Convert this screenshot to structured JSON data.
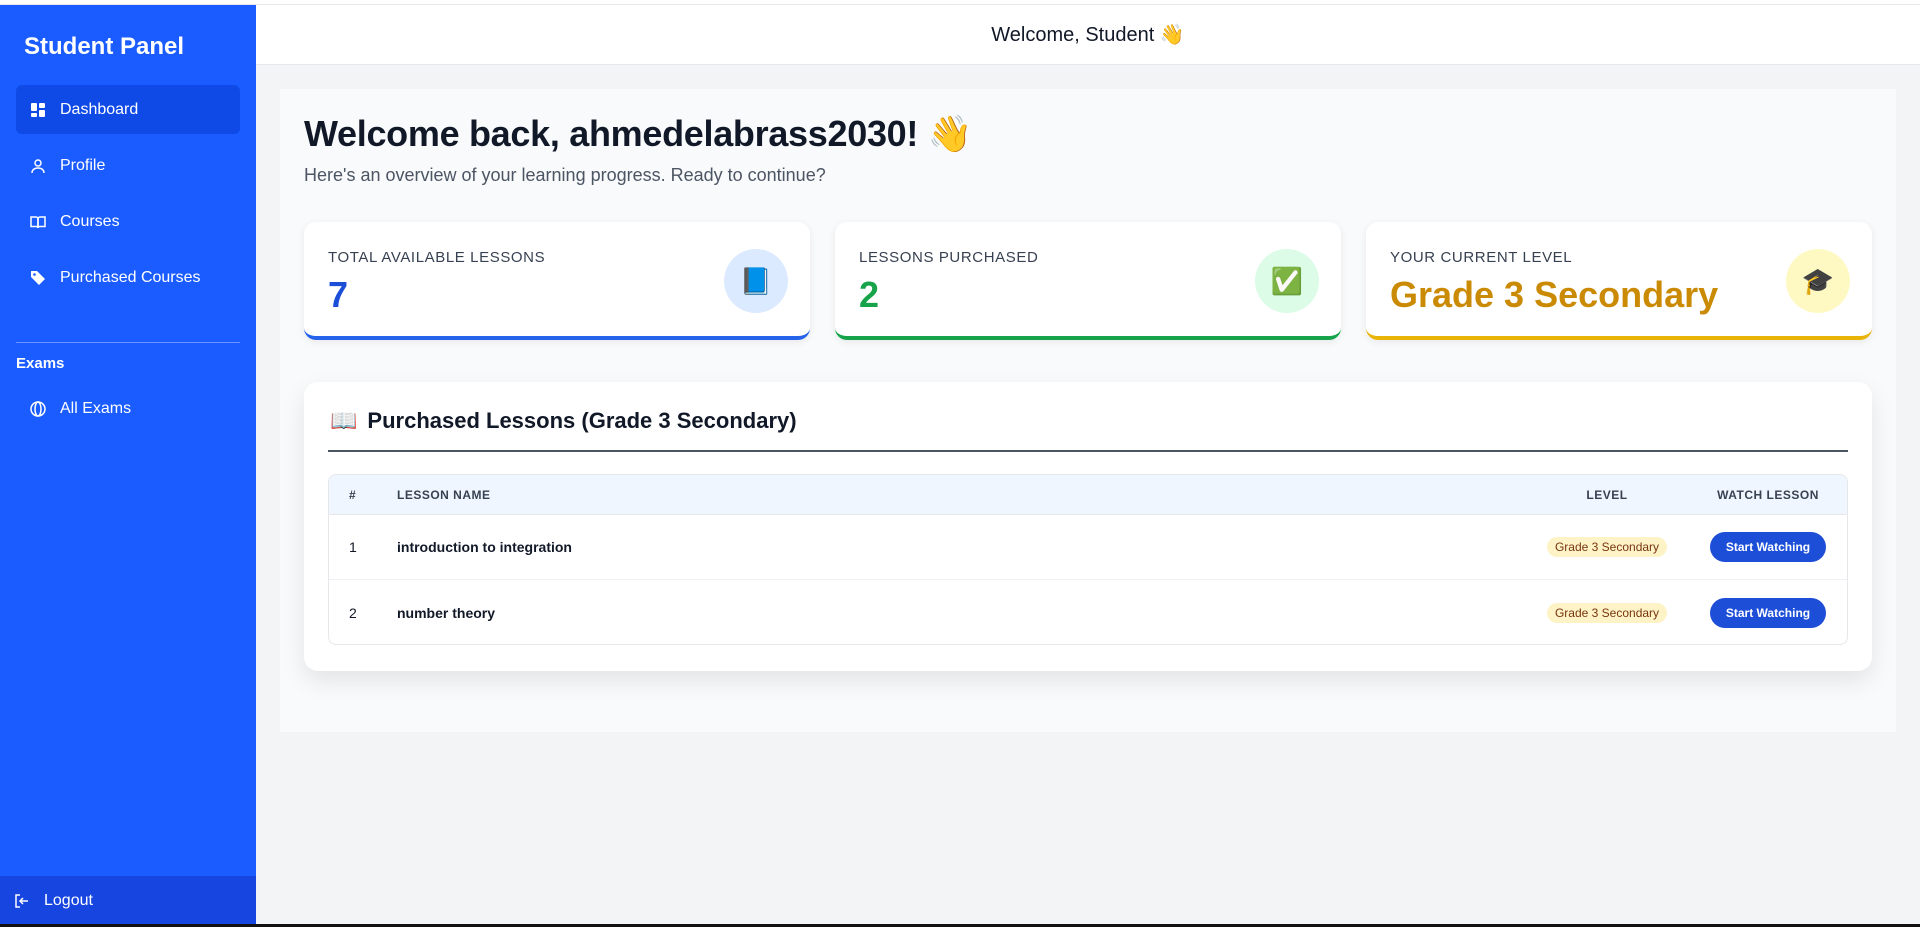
{
  "sidebar": {
    "title": "Student Panel",
    "items": [
      {
        "label": "Dashboard",
        "icon": "dashboard-icon",
        "active": true
      },
      {
        "label": "Profile",
        "icon": "user-icon"
      },
      {
        "label": "Courses",
        "icon": "book-icon"
      },
      {
        "label": "Purchased Courses",
        "icon": "tag-icon"
      }
    ],
    "exams_section": "Exams",
    "exam_items": [
      {
        "label": "All Exams",
        "icon": "globe-icon"
      }
    ],
    "logout_label": "Logout"
  },
  "topbar": {
    "greeting": "Welcome, Student 👋"
  },
  "main": {
    "welcome": "Welcome back, ahmedelabrass2030! 👋",
    "subtitle": "Here's an overview of your learning progress. Ready to continue?",
    "stats": [
      {
        "label": "TOTAL AVAILABLE LESSONS",
        "value": "7",
        "icon": "📘",
        "color": "#2563eb"
      },
      {
        "label": "LESSONS PURCHASED",
        "value": "2",
        "icon": "✅",
        "color": "#16a34a"
      },
      {
        "label": "YOUR CURRENT LEVEL",
        "value": "Grade 3 Secondary",
        "icon": "🎓",
        "color": "#ca8a04"
      }
    ],
    "purchased": {
      "icon": "📖",
      "title": "Purchased Lessons (Grade 3 Secondary)",
      "columns": [
        "#",
        "LESSON NAME",
        "LEVEL",
        "WATCH LESSON"
      ],
      "rows": [
        {
          "num": "1",
          "name": "introduction to integration",
          "level": "Grade 3 Secondary",
          "action": "Start Watching"
        },
        {
          "num": "2",
          "name": "number theory",
          "level": "Grade 3 Secondary",
          "action": "Start Watching"
        }
      ]
    }
  },
  "colors": {
    "sidebar": "#1a5cff",
    "primary_button": "#1d4ed8",
    "badge_bg": "#fef3c7"
  }
}
